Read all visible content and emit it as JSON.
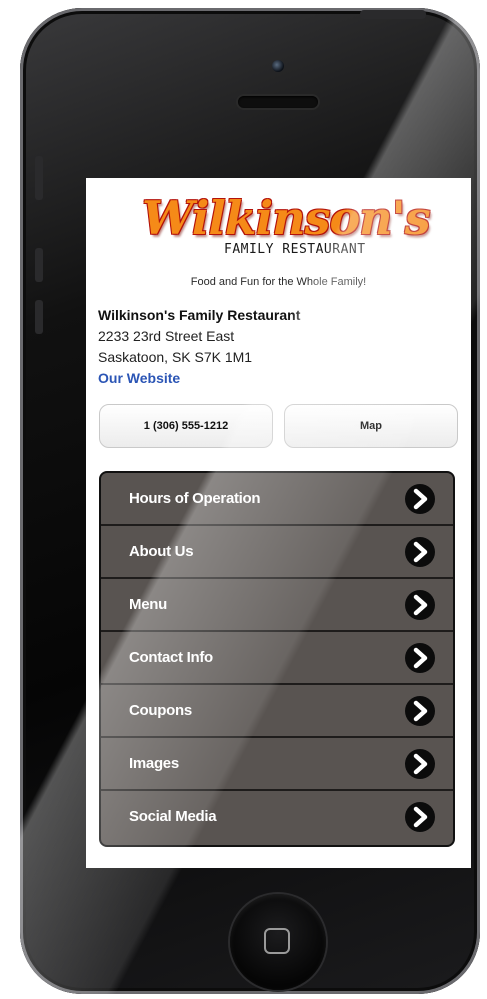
{
  "logo": {
    "script_text": "Wilkinson's",
    "subtext": "FAMILY RESTAURANT"
  },
  "tagline": "Food and Fun for the Whole Family!",
  "business": {
    "name": "Wilkinson's Family Restaurant",
    "street": "2233 23rd Street East",
    "city": "Saskatoon, SK S7K 1M1",
    "website_label": "Our Website"
  },
  "actions": {
    "phone_label": "1 (306) 555-1212",
    "map_label": "Map"
  },
  "menu": {
    "items": [
      {
        "label": "Hours of Operation",
        "icon": "chevron-right-icon"
      },
      {
        "label": "About Us",
        "icon": "chevron-right-icon"
      },
      {
        "label": "Menu",
        "icon": "chevron-right-icon"
      },
      {
        "label": "Contact Info",
        "icon": "chevron-right-icon"
      },
      {
        "label": "Coupons",
        "icon": "chevron-right-icon"
      },
      {
        "label": "Images",
        "icon": "chevron-right-icon"
      },
      {
        "label": "Social Media",
        "icon": "chevron-right-icon"
      }
    ]
  },
  "colors": {
    "logo_orange": "#f58a18",
    "logo_red": "#b3120a",
    "link_blue": "#2b55b5",
    "menu_bg": "#595451"
  }
}
